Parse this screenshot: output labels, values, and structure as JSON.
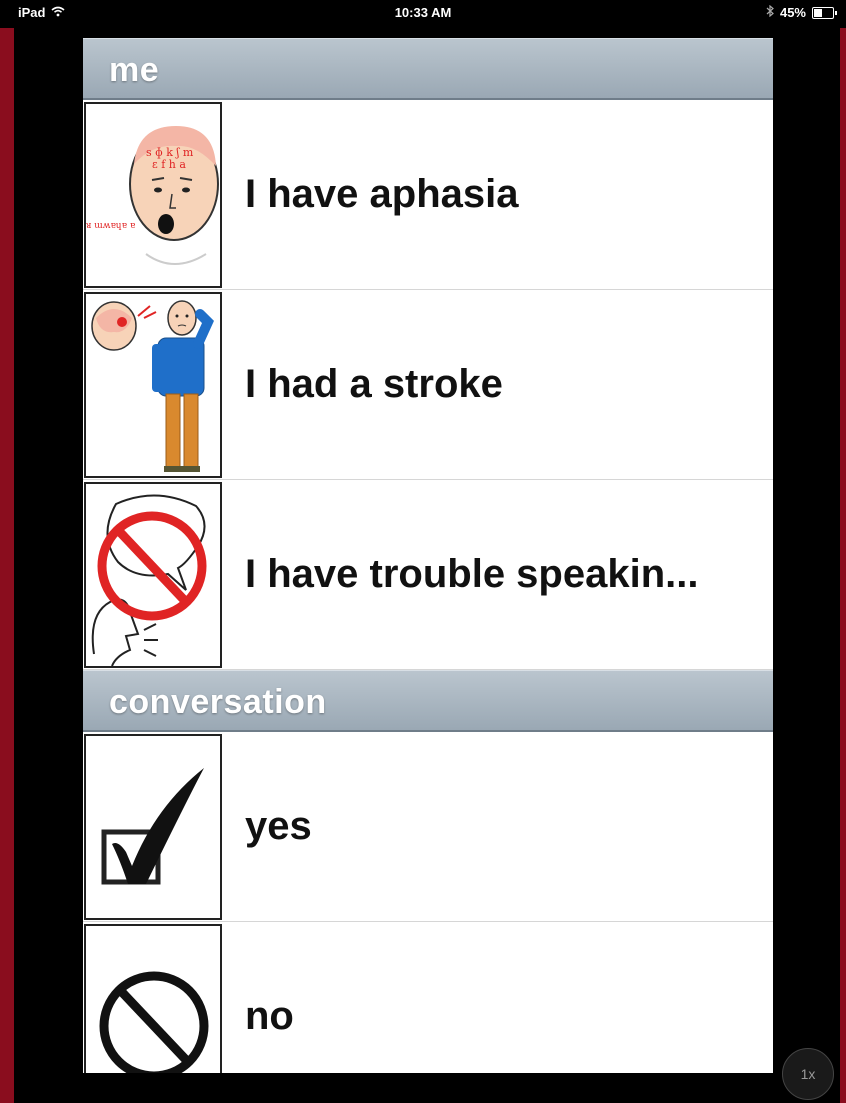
{
  "status_bar": {
    "device": "iPad",
    "time": "10:33 AM",
    "battery_text": "45%",
    "battery_level": 0.45
  },
  "sections": [
    {
      "title": "me",
      "items": [
        {
          "label": "I have aphasia",
          "icon": "aphasia-icon"
        },
        {
          "label": "I had a stroke",
          "icon": "stroke-icon"
        },
        {
          "label": "I have trouble speakin...",
          "icon": "trouble-speaking-icon"
        }
      ]
    },
    {
      "title": "conversation",
      "items": [
        {
          "label": "yes",
          "icon": "checkbox-check-icon"
        },
        {
          "label": "no",
          "icon": "prohibited-icon"
        }
      ]
    }
  ],
  "zoom_button": "1x",
  "colors": {
    "background": "#8a0d1e",
    "header": "#a9b5c0",
    "prohibition": "#e02424"
  }
}
